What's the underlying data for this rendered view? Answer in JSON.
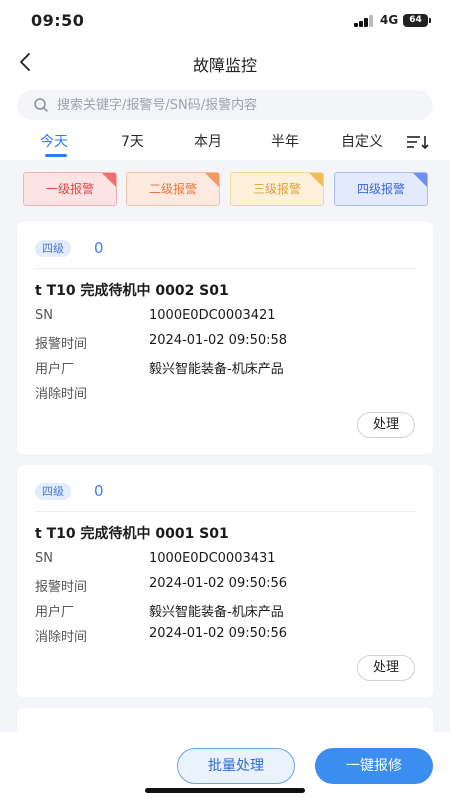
{
  "status_bar": {
    "time": "09:50",
    "network": "4G",
    "battery": "64"
  },
  "header": {
    "title": "故障监控",
    "back_icon": "chevron-left-icon"
  },
  "search": {
    "placeholder": "搜索关键字/报警号/SN码/报警内容",
    "value": "",
    "icon": "search-icon"
  },
  "tabs": [
    {
      "label": "今天",
      "active": true
    },
    {
      "label": "7天",
      "active": false
    },
    {
      "label": "本月",
      "active": false
    },
    {
      "label": "半年",
      "active": false
    },
    {
      "label": "自定义",
      "active": false
    }
  ],
  "levels": [
    {
      "label": "一级报警",
      "color": "#e04848"
    },
    {
      "label": "二级报警",
      "color": "#e8793f"
    },
    {
      "label": "三级报警",
      "color": "#e0a23a"
    },
    {
      "label": "四级报警",
      "color": "#4169d6"
    }
  ],
  "alarms": [
    {
      "level_badge": "四级",
      "count": "0",
      "title": "t T10 完成待机中 0002 S01",
      "fields": [
        {
          "label": "SN",
          "value": "1000E0DC0003421"
        },
        {
          "label": "报警时间",
          "value": "2024-01-02 09:50:58"
        },
        {
          "label": "用户厂",
          "value": "毅兴智能装备-机床产品"
        },
        {
          "label": "消除时间",
          "value": ""
        }
      ],
      "action": "处理"
    },
    {
      "level_badge": "四级",
      "count": "0",
      "title": "t T10 完成待机中 0001 S01",
      "fields": [
        {
          "label": "SN",
          "value": "1000E0DC0003431"
        },
        {
          "label": "报警时间",
          "value": "2024-01-02 09:50:56"
        },
        {
          "label": "用户厂",
          "value": "毅兴智能装备-机床产品"
        },
        {
          "label": "消除时间",
          "value": "2024-01-02 09:50:56"
        }
      ],
      "action": "处理"
    }
  ],
  "bottom": {
    "batch_label": "批量处理",
    "repair_label": "一键报修"
  },
  "colors": {
    "accent": "#2d7cf6",
    "primary_button": "#3b8ef0"
  }
}
